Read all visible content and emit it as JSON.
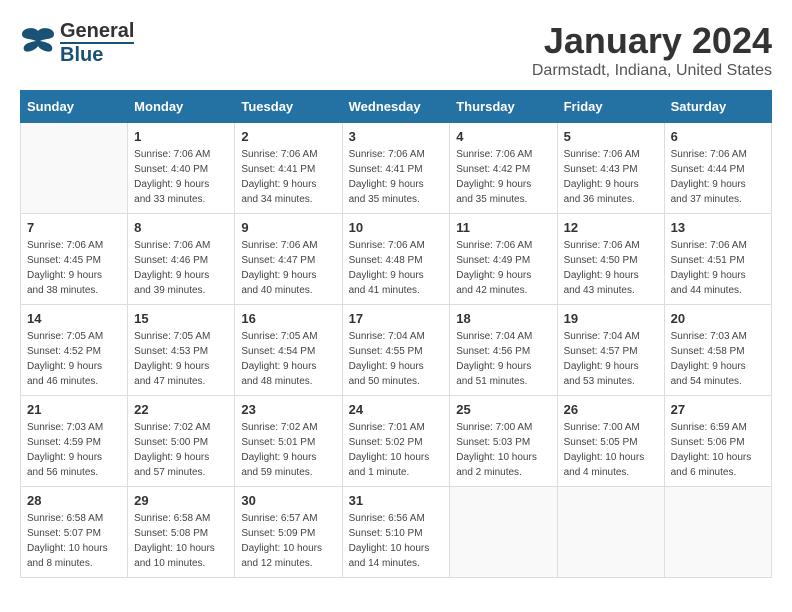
{
  "logo": {
    "general": "General",
    "blue": "Blue"
  },
  "title": "January 2024",
  "subtitle": "Darmstadt, Indiana, United States",
  "days_of_week": [
    "Sunday",
    "Monday",
    "Tuesday",
    "Wednesday",
    "Thursday",
    "Friday",
    "Saturday"
  ],
  "weeks": [
    [
      {
        "day": "",
        "info": ""
      },
      {
        "day": "1",
        "info": "Sunrise: 7:06 AM\nSunset: 4:40 PM\nDaylight: 9 hours\nand 33 minutes."
      },
      {
        "day": "2",
        "info": "Sunrise: 7:06 AM\nSunset: 4:41 PM\nDaylight: 9 hours\nand 34 minutes."
      },
      {
        "day": "3",
        "info": "Sunrise: 7:06 AM\nSunset: 4:41 PM\nDaylight: 9 hours\nand 35 minutes."
      },
      {
        "day": "4",
        "info": "Sunrise: 7:06 AM\nSunset: 4:42 PM\nDaylight: 9 hours\nand 35 minutes."
      },
      {
        "day": "5",
        "info": "Sunrise: 7:06 AM\nSunset: 4:43 PM\nDaylight: 9 hours\nand 36 minutes."
      },
      {
        "day": "6",
        "info": "Sunrise: 7:06 AM\nSunset: 4:44 PM\nDaylight: 9 hours\nand 37 minutes."
      }
    ],
    [
      {
        "day": "7",
        "info": ""
      },
      {
        "day": "8",
        "info": "Sunrise: 7:06 AM\nSunset: 4:46 PM\nDaylight: 9 hours\nand 39 minutes."
      },
      {
        "day": "9",
        "info": "Sunrise: 7:06 AM\nSunset: 4:47 PM\nDaylight: 9 hours\nand 40 minutes."
      },
      {
        "day": "10",
        "info": "Sunrise: 7:06 AM\nSunset: 4:48 PM\nDaylight: 9 hours\nand 41 minutes."
      },
      {
        "day": "11",
        "info": "Sunrise: 7:06 AM\nSunset: 4:49 PM\nDaylight: 9 hours\nand 42 minutes."
      },
      {
        "day": "12",
        "info": "Sunrise: 7:06 AM\nSunset: 4:50 PM\nDaylight: 9 hours\nand 43 minutes."
      },
      {
        "day": "13",
        "info": "Sunrise: 7:06 AM\nSunset: 4:51 PM\nDaylight: 9 hours\nand 44 minutes."
      }
    ],
    [
      {
        "day": "14",
        "info": ""
      },
      {
        "day": "15",
        "info": "Sunrise: 7:05 AM\nSunset: 4:53 PM\nDaylight: 9 hours\nand 47 minutes."
      },
      {
        "day": "16",
        "info": "Sunrise: 7:05 AM\nSunset: 4:54 PM\nDaylight: 9 hours\nand 48 minutes."
      },
      {
        "day": "17",
        "info": "Sunrise: 7:04 AM\nSunset: 4:55 PM\nDaylight: 9 hours\nand 50 minutes."
      },
      {
        "day": "18",
        "info": "Sunrise: 7:04 AM\nSunset: 4:56 PM\nDaylight: 9 hours\nand 51 minutes."
      },
      {
        "day": "19",
        "info": "Sunrise: 7:04 AM\nSunset: 4:57 PM\nDaylight: 9 hours\nand 53 minutes."
      },
      {
        "day": "20",
        "info": "Sunrise: 7:03 AM\nSunset: 4:58 PM\nDaylight: 9 hours\nand 54 minutes."
      }
    ],
    [
      {
        "day": "21",
        "info": ""
      },
      {
        "day": "22",
        "info": "Sunrise: 7:02 AM\nSunset: 5:00 PM\nDaylight: 9 hours\nand 57 minutes."
      },
      {
        "day": "23",
        "info": "Sunrise: 7:02 AM\nSunset: 5:01 PM\nDaylight: 9 hours\nand 59 minutes."
      },
      {
        "day": "24",
        "info": "Sunrise: 7:01 AM\nSunset: 5:02 PM\nDaylight: 10 hours\nand 1 minute."
      },
      {
        "day": "25",
        "info": "Sunrise: 7:00 AM\nSunset: 5:03 PM\nDaylight: 10 hours\nand 2 minutes."
      },
      {
        "day": "26",
        "info": "Sunrise: 7:00 AM\nSunset: 5:05 PM\nDaylight: 10 hours\nand 4 minutes."
      },
      {
        "day": "27",
        "info": "Sunrise: 6:59 AM\nSunset: 5:06 PM\nDaylight: 10 hours\nand 6 minutes."
      }
    ],
    [
      {
        "day": "28",
        "info": ""
      },
      {
        "day": "29",
        "info": "Sunrise: 6:58 AM\nSunset: 5:08 PM\nDaylight: 10 hours\nand 10 minutes."
      },
      {
        "day": "30",
        "info": "Sunrise: 6:57 AM\nSunset: 5:09 PM\nDaylight: 10 hours\nand 12 minutes."
      },
      {
        "day": "31",
        "info": "Sunrise: 6:56 AM\nSunset: 5:10 PM\nDaylight: 10 hours\nand 14 minutes."
      },
      {
        "day": "",
        "info": ""
      },
      {
        "day": "",
        "info": ""
      },
      {
        "day": "",
        "info": ""
      }
    ]
  ],
  "week1_sunday_info": "Sunrise: 7:06 AM\nSunset: 4:45 PM\nDaylight: 9 hours\nand 38 minutes.",
  "week3_sunday_info": "Sunrise: 7:05 AM\nSunset: 4:52 PM\nDaylight: 9 hours\nand 46 minutes.",
  "week4_sunday_info": "Sunrise: 7:03 AM\nSunset: 4:59 PM\nDaylight: 9 hours\nand 56 minutes.",
  "week5_sunday_info": "Sunrise: 6:58 AM\nSunset: 5:07 PM\nDaylight: 10 hours\nand 8 minutes."
}
